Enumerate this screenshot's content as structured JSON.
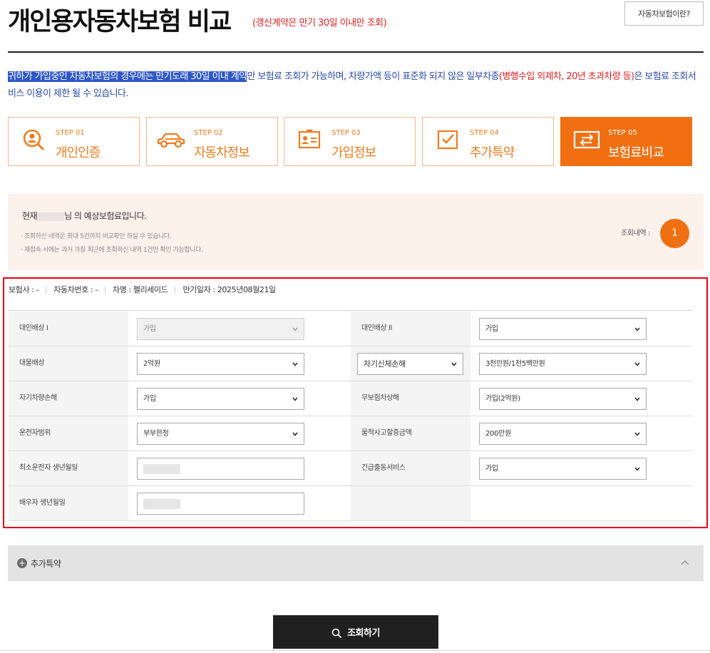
{
  "header": {
    "title": "개인용자동차보험 비교",
    "subtitle": "(갱신계약은 만기 30일 이내만 조회)",
    "help_button": "자동차보험이란?"
  },
  "notice": {
    "highlighted": "귀하가 가입중인 자동차보험의 경우에는 만기도래 30일 이내 계약",
    "text1": "만 보험료 조회가 가능하며, 차량가액 등이 표준화 되지 않은 일부차종",
    "red": "(병행수입 외제차, 20년 초과차량 등)",
    "text2": "은 보험료 조회서비스 이용이 제한 될 수 있습니다."
  },
  "steps": [
    {
      "num": "STEP 01",
      "label": "개인인증",
      "icon": "search-person-icon",
      "active": false
    },
    {
      "num": "STEP 02",
      "label": "자동차정보",
      "icon": "car-icon",
      "active": false
    },
    {
      "num": "STEP 03",
      "label": "가입정보",
      "icon": "id-card-icon",
      "active": false
    },
    {
      "num": "STEP 04",
      "label": "추가특약",
      "icon": "checkbox-icon",
      "active": false
    },
    {
      "num": "STEP 05",
      "label": "보험료비교",
      "icon": "compare-icon",
      "active": true
    }
  ],
  "estimate": {
    "prefix": "현재",
    "suffix": "님 의 예상보험료입니다.",
    "note1": "· 조회하신 내역은 최대 5건까지 비교확인 하실 수 있습니다.",
    "note2": "· 재접속 시에는 과거 가장 최근에 조회하신 내역 1건만 확인 가능합니다.",
    "history_label": "조회내역 :",
    "history_count": "1"
  },
  "contract": {
    "insurer": "보험사 : -",
    "car_number": "자동차번호 : -",
    "car_name": "차명 : 펠리세이드",
    "expiry": "만기일자 : 2025년08월21일"
  },
  "form": {
    "bodily_1": {
      "label": "대인배상 I",
      "value": "가입"
    },
    "bodily_2": {
      "label": "대인배상 II",
      "value": "가입"
    },
    "property": {
      "label": "대물배상",
      "value": "2억원"
    },
    "self_injury_type": {
      "value": "자기신체손해"
    },
    "self_injury": {
      "value": "3천만원/1천5백만원"
    },
    "own_vehicle": {
      "label": "자기차량손해",
      "value": "가입"
    },
    "uninsured": {
      "label": "무보험차상해",
      "value": "가입(2억원)"
    },
    "driver_scope": {
      "label": "운전자범위",
      "value": "부부한정"
    },
    "property_surcharge": {
      "label": "물적사고할증금액",
      "value": "200만원"
    },
    "youngest_birth": {
      "label": "최소운전자 생년월일"
    },
    "emergency": {
      "label": "긴급출동서비스",
      "value": "가입"
    },
    "spouse_birth": {
      "label": "배우자 생년월일"
    }
  },
  "addon": {
    "label": "추가특약"
  },
  "search_button": "조회하기",
  "colors": {
    "accent": "#f07011",
    "highlight_border": "#e60012",
    "notice_blue": "#2a4aa8"
  }
}
